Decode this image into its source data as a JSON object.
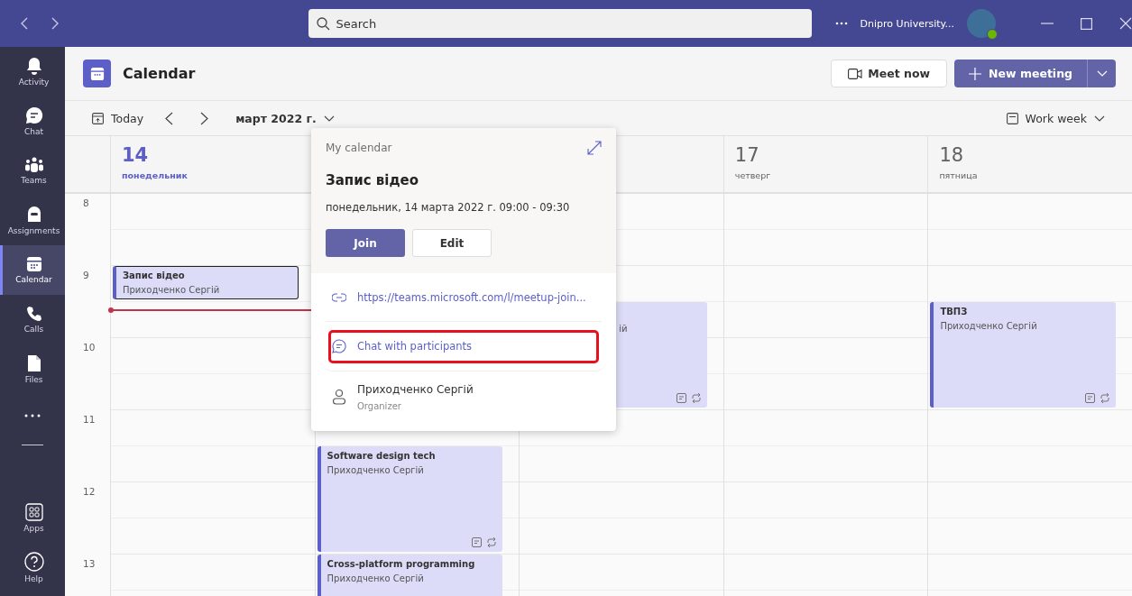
{
  "title_bar": {
    "search": {
      "placeholder": "Search"
    },
    "org": "Dnipro University..."
  },
  "sidebar": {
    "items": [
      {
        "kind": "bell",
        "label": "Activity",
        "selected": false
      },
      {
        "kind": "chat",
        "label": "Chat",
        "selected": false
      },
      {
        "kind": "teams",
        "label": "Teams",
        "selected": false
      },
      {
        "kind": "backpack",
        "label": "Assignments",
        "selected": false
      },
      {
        "kind": "calendar",
        "label": "Calendar",
        "selected": true
      },
      {
        "kind": "phone",
        "label": "Calls",
        "selected": false
      },
      {
        "kind": "file",
        "label": "Files",
        "selected": false
      }
    ],
    "bottom_items": [
      {
        "kind": "apps",
        "label": "Apps",
        "selected": false
      },
      {
        "kind": "help",
        "label": "Help",
        "selected": false
      }
    ]
  },
  "header": {
    "title": "Calendar",
    "meet_now": "Meet now",
    "new_meeting": "New meeting"
  },
  "toolbar": {
    "today": "Today",
    "month": "март 2022 г.",
    "view": "Work week"
  },
  "hours": [
    "8",
    "9",
    "10",
    "11",
    "12",
    "13"
  ],
  "days": [
    {
      "number": "14",
      "weekday": "понедельник",
      "today": true,
      "events": [
        {
          "kind": "full",
          "title": "Запис відео",
          "organizer": "Приходченко Сергій",
          "selected": true
        }
      ]
    },
    {
      "events": [
        {
          "kind": "full",
          "title": "Software design tech",
          "organizer": "Приходченко Сергій",
          "selected": false,
          "note_icons": true
        },
        {
          "kind": "full",
          "title": "Cross-platform programming",
          "organizer": "Приходченко Сергій",
          "selected": false
        }
      ]
    },
    {
      "events": [
        {
          "kind": "partial",
          "organizer": "ій",
          "selected": false,
          "note_icons": true
        }
      ]
    },
    {
      "number": "17",
      "weekday": "четверг",
      "today": false
    },
    {
      "number": "18",
      "weekday": "пятница",
      "today": false,
      "events": [
        {
          "kind": "full",
          "title": "ТВПЗ",
          "organizer": "Приходченко Сергій",
          "selected": false,
          "note_icons": true
        }
      ]
    }
  ],
  "popup": {
    "calendar": "My calendar",
    "title": "Запис відео",
    "when": "понедельник, 14 марта 2022 г. 09:00 - 09:30",
    "join": "Join",
    "edit": "Edit",
    "link": "https://teams.microsoft.com/l/meetup-join...",
    "chat": "Chat with participants",
    "chat_highlighted": true,
    "organizer": "Приходченко Сергій",
    "organizer_role": "Organizer"
  }
}
